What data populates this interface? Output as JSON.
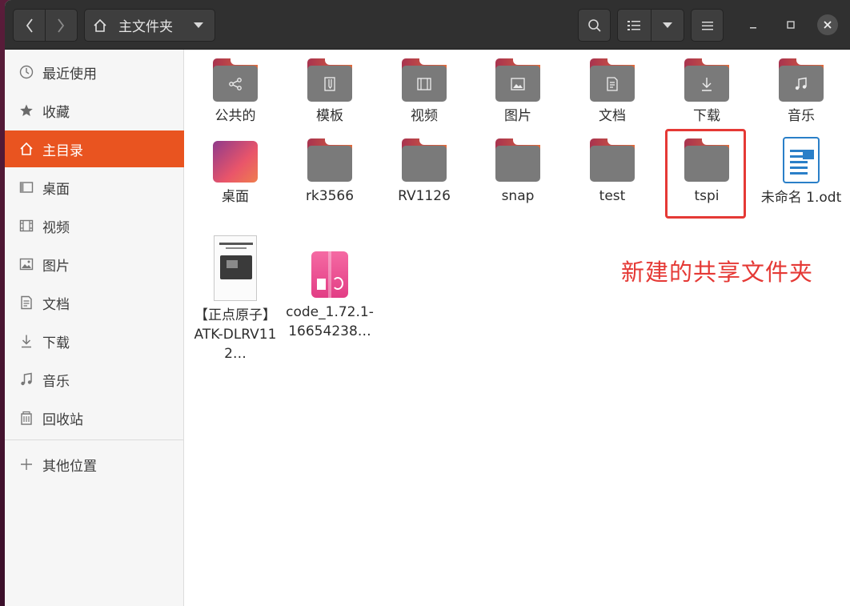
{
  "window": {
    "path_label": "主文件夹"
  },
  "sidebar": {
    "items": [
      {
        "label": "最近使用",
        "icon": "clock-icon"
      },
      {
        "label": "收藏",
        "icon": "star-icon"
      },
      {
        "label": "主目录",
        "icon": "home-icon",
        "active": true
      },
      {
        "label": "桌面",
        "icon": "desktop-icon"
      },
      {
        "label": "视频",
        "icon": "video-icon"
      },
      {
        "label": "图片",
        "icon": "image-icon"
      },
      {
        "label": "文档",
        "icon": "document-icon"
      },
      {
        "label": "下载",
        "icon": "download-icon"
      },
      {
        "label": "音乐",
        "icon": "music-icon"
      },
      {
        "label": "回收站",
        "icon": "trash-icon"
      },
      {
        "label": "其他位置",
        "icon": "plus-icon"
      }
    ]
  },
  "files": [
    {
      "label": "公共的",
      "kind": "folder",
      "emblem": "share-icon"
    },
    {
      "label": "模板",
      "kind": "folder",
      "emblem": "template-icon"
    },
    {
      "label": "视频",
      "kind": "folder",
      "emblem": "video-icon"
    },
    {
      "label": "图片",
      "kind": "folder",
      "emblem": "image-icon"
    },
    {
      "label": "文档",
      "kind": "folder",
      "emblem": "document-icon"
    },
    {
      "label": "下载",
      "kind": "folder",
      "emblem": "download-icon"
    },
    {
      "label": "音乐",
      "kind": "folder",
      "emblem": "music-icon"
    },
    {
      "label": "桌面",
      "kind": "desktop-folder"
    },
    {
      "label": "rk3566",
      "kind": "folder"
    },
    {
      "label": "RV1126",
      "kind": "folder"
    },
    {
      "label": "snap",
      "kind": "folder"
    },
    {
      "label": "test",
      "kind": "folder"
    },
    {
      "label": "tspi",
      "kind": "folder",
      "highlighted": true
    },
    {
      "label": "未命名 1.odt",
      "kind": "odt-file"
    },
    {
      "label": "【正点原子】ATK-DLRV112…",
      "kind": "pdf-file"
    },
    {
      "label": "code_1.72.1-16654238…",
      "kind": "deb-file"
    }
  ],
  "annotation": {
    "text": "新建的共享文件夹",
    "color": "#e53935"
  },
  "colors": {
    "accent": "#e95420",
    "headerbar": "#303030",
    "highlight_border": "#e53935"
  }
}
